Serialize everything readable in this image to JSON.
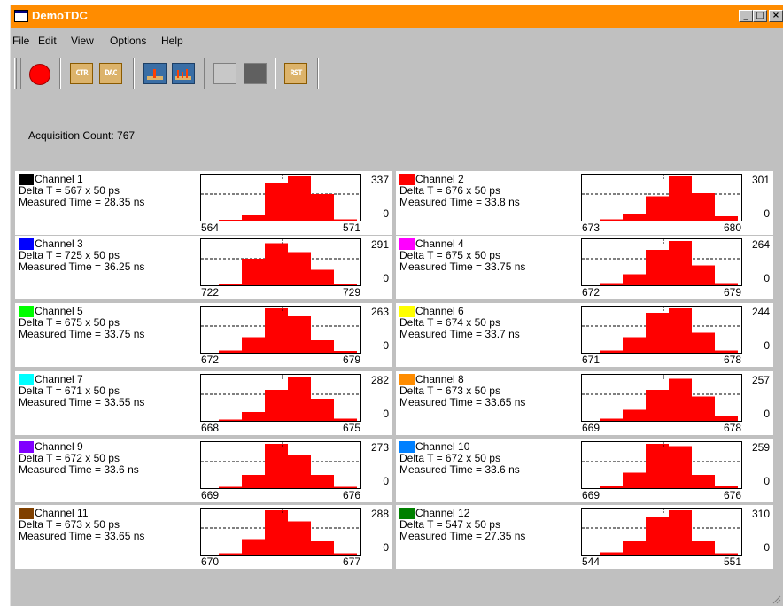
{
  "window": {
    "title": "DemoTDC",
    "titlebar_color": "#ff8c00",
    "controls": {
      "minimize": "_",
      "maximize": "□",
      "close": "×"
    }
  },
  "menu": [
    "File",
    "Edit",
    "View",
    "Options",
    "Help"
  ],
  "toolbar": {
    "record_icon": "red-record-circle",
    "ctr_label": "CTR",
    "dac_label": "DAC",
    "histogram_icon": "single-histogram",
    "multi_histogram_icon": "multi-histogram",
    "rst_label": "RST"
  },
  "acquisition": {
    "label": "Acquisition Count: 767"
  },
  "channels": [
    {
      "name": "Channel 1",
      "color": "#000000",
      "delta": "Delta T = 567 x 50 ps",
      "measured": "Measured Time = 28.35 ns",
      "ymax": "337",
      "ymin": "0",
      "xmin": "564",
      "xmax": "571",
      "bins": [
        0.02,
        0.12,
        0.85,
        1.0,
        0.6,
        0.03
      ]
    },
    {
      "name": "Channel 2",
      "color": "#ff0000",
      "delta": "Delta T = 676 x 50 ps",
      "measured": "Measured Time = 33.8 ns",
      "ymax": "301",
      "ymin": "0",
      "xmin": "673",
      "xmax": "680",
      "bins": [
        0.03,
        0.15,
        0.55,
        1.0,
        0.62,
        0.1
      ]
    },
    {
      "name": "Channel 3",
      "color": "#0000ff",
      "delta": "Delta T = 725 x 50 ps",
      "measured": "Measured Time = 36.25 ns",
      "ymax": "291",
      "ymin": "0",
      "xmin": "722",
      "xmax": "729",
      "bins": [
        0.03,
        0.6,
        0.95,
        0.75,
        0.35,
        0.03
      ]
    },
    {
      "name": "Channel 4",
      "color": "#ff00ff",
      "delta": "Delta T = 675 x 50 ps",
      "measured": "Measured Time = 33.75 ns",
      "ymax": "264",
      "ymin": "0",
      "xmin": "672",
      "xmax": "679",
      "bins": [
        0.05,
        0.25,
        0.8,
        1.0,
        0.45,
        0.05
      ]
    },
    {
      "name": "Channel 5",
      "color": "#00ff00",
      "delta": "Delta T = 675 x 50 ps",
      "measured": "Measured Time = 33.75 ns",
      "ymax": "263",
      "ymin": "0",
      "xmin": "672",
      "xmax": "679",
      "bins": [
        0.05,
        0.35,
        1.0,
        0.82,
        0.28,
        0.04
      ]
    },
    {
      "name": "Channel 6",
      "color": "#ffff00",
      "delta": "Delta T = 674 x 50 ps",
      "measured": "Measured Time = 33.7 ns",
      "ymax": "244",
      "ymin": "0",
      "xmin": "671",
      "xmax": "678",
      "bins": [
        0.05,
        0.35,
        0.9,
        1.0,
        0.45,
        0.05
      ]
    },
    {
      "name": "Channel 7",
      "color": "#00ffff",
      "delta": "Delta T = 671 x 50 ps",
      "measured": "Measured Time = 33.55 ns",
      "ymax": "282",
      "ymin": "0",
      "xmin": "668",
      "xmax": "675",
      "bins": [
        0.03,
        0.2,
        0.7,
        1.0,
        0.5,
        0.05
      ]
    },
    {
      "name": "Channel 8",
      "color": "#ff8c00",
      "delta": "Delta T = 673 x 50 ps",
      "measured": "Measured Time = 33.65 ns",
      "ymax": "257",
      "ymin": "0",
      "xmin": "669",
      "xmax": "678",
      "bins": [
        0.05,
        0.25,
        0.7,
        0.95,
        0.55,
        0.12
      ]
    },
    {
      "name": "Channel 9",
      "color": "#8000ff",
      "delta": "Delta T = 672 x 50 ps",
      "measured": "Measured Time = 33.6 ns",
      "ymax": "273",
      "ymin": "0",
      "xmin": "669",
      "xmax": "676",
      "bins": [
        0.03,
        0.3,
        1.0,
        0.75,
        0.3,
        0.03
      ]
    },
    {
      "name": "Channel 10",
      "color": "#0080ff",
      "delta": "Delta T = 672 x 50 ps",
      "measured": "Measured Time = 33.6 ns",
      "ymax": "259",
      "ymin": "0",
      "xmin": "669",
      "xmax": "676",
      "bins": [
        0.05,
        0.35,
        1.0,
        0.95,
        0.3,
        0.04
      ]
    },
    {
      "name": "Channel 11",
      "color": "#804000",
      "delta": "Delta T = 673 x 50 ps",
      "measured": "Measured Time = 33.65 ns",
      "ymax": "288",
      "ymin": "0",
      "xmin": "670",
      "xmax": "677",
      "bins": [
        0.03,
        0.35,
        1.0,
        0.75,
        0.3,
        0.03
      ]
    },
    {
      "name": "Channel 12",
      "color": "#008000",
      "delta": "Delta T = 547 x 50 ps",
      "measured": "Measured Time = 27.35 ns",
      "ymax": "310",
      "ymin": "0",
      "xmin": "544",
      "xmax": "551",
      "bins": [
        0.05,
        0.3,
        0.85,
        1.0,
        0.3,
        0.03
      ]
    }
  ]
}
